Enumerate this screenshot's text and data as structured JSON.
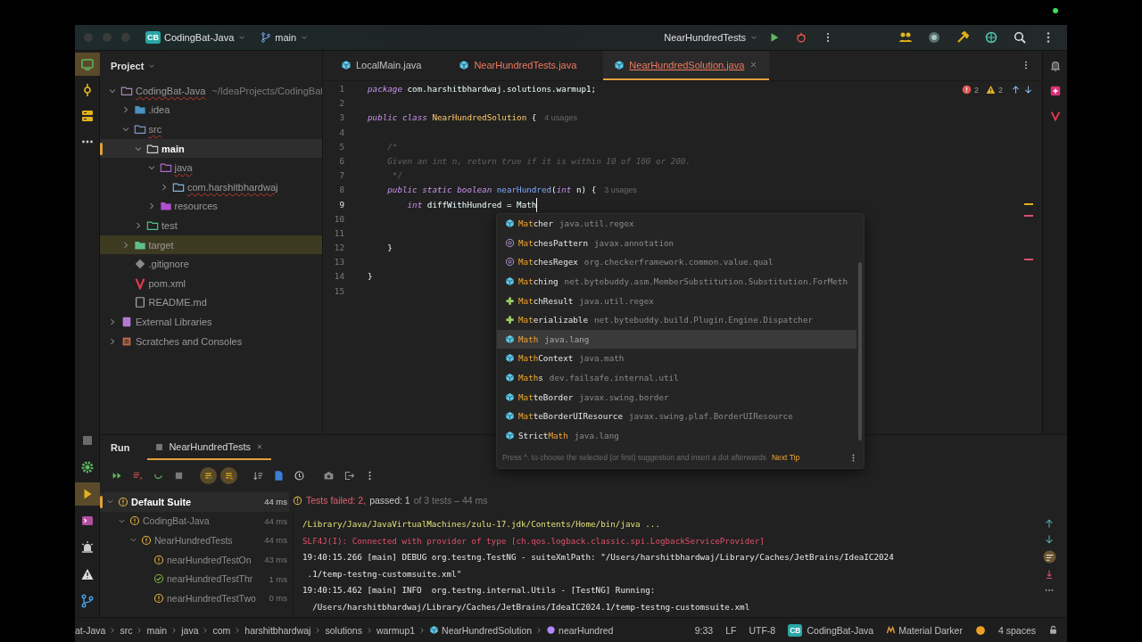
{
  "title_bar": {
    "project_badge": "CB",
    "project": "CodingBat-Java",
    "branch": "main",
    "run_config": "NearHundredTests"
  },
  "left_toolbar": {
    "top": [
      {
        "selected": true
      },
      {
        "selected": false
      },
      {
        "selected": false
      },
      {
        "selected": false
      }
    ],
    "bottom": [
      {
        "selected": false
      },
      {
        "selected": false
      },
      {
        "selected": true
      },
      {
        "selected": false
      },
      {
        "selected": false
      },
      {
        "selected": false
      },
      {
        "selected": false
      }
    ]
  },
  "project_panel": {
    "title": "Project",
    "tree": [
      {
        "label": "CodingBat-Java",
        "path": "~/IdeaProjects/CodingBat",
        "kind": "module",
        "expanded": true,
        "selected": false,
        "highlighted": false,
        "errors": true,
        "children": [
          {
            "label": ".idea",
            "kind": "config-folder",
            "expanded": false,
            "selected": false,
            "highlighted": false,
            "errors": false
          },
          {
            "label": "src",
            "kind": "source-folder",
            "expanded": true,
            "selected": false,
            "highlighted": false,
            "errors": true,
            "children": [
              {
                "label": "main",
                "kind": "folder",
                "expanded": true,
                "selected": true,
                "highlighted": false,
                "errors": false,
                "children": [
                  {
                    "label": "java",
                    "kind": "source-root",
                    "expanded": true,
                    "selected": false,
                    "highlighted": false,
                    "errors": true,
                    "children": [
                      {
                        "label": "com.harshitbhardwaj",
                        "kind": "package",
                        "expanded": false,
                        "selected": false,
                        "highlighted": false,
                        "errors": true
                      }
                    ]
                  },
                  {
                    "label": "resources",
                    "kind": "resource-root",
                    "expanded": false,
                    "selected": false,
                    "highlighted": false,
                    "errors": false
                  }
                ]
              },
              {
                "label": "test",
                "kind": "test-root",
                "expanded": false,
                "selected": false,
                "highlighted": false,
                "errors": false
              }
            ]
          },
          {
            "label": "target",
            "kind": "excluded-folder",
            "expanded": false,
            "selected": false,
            "highlighted": true,
            "errors": false
          },
          {
            "label": ".gitignore",
            "kind": "git-file",
            "selected": false,
            "highlighted": false,
            "errors": false
          },
          {
            "label": "pom.xml",
            "kind": "maven-file",
            "selected": false,
            "highlighted": false,
            "errors": false
          },
          {
            "label": "README.md",
            "kind": "markdown-file",
            "selected": false,
            "highlighted": false,
            "errors": false
          }
        ]
      },
      {
        "label": "External Libraries",
        "kind": "libraries",
        "expanded": false,
        "selected": false,
        "highlighted": false,
        "errors": false
      },
      {
        "label": "Scratches and Consoles",
        "kind": "scratches",
        "expanded": false,
        "selected": false,
        "highlighted": false,
        "errors": false
      }
    ]
  },
  "editor": {
    "tabs": [
      {
        "label": "LocalMain.java",
        "selected": false,
        "errors": false
      },
      {
        "label": "NearHundredTests.java",
        "selected": false,
        "errors": true
      },
      {
        "label": "NearHundredSolution.java",
        "selected": true,
        "errors": true
      }
    ],
    "inspections": {
      "errors": "2",
      "warnings": "2"
    },
    "lines": [
      {
        "number": "1",
        "current": false,
        "tokens": [
          {
            "kind": "keyword",
            "text": "package"
          },
          {
            "kind": "plain",
            "text": " com.harshitbhardwaj.solutions.warmup1;"
          }
        ]
      },
      {
        "number": "2",
        "current": false
      },
      {
        "number": "3",
        "current": false,
        "tokens": [
          {
            "kind": "keyword",
            "text": "public class"
          },
          {
            "kind": "type",
            "text": " NearHundredSolution"
          },
          {
            "kind": "plain",
            "text": " {"
          }
        ],
        "hint": "4 usages"
      },
      {
        "number": "4",
        "current": false
      },
      {
        "number": "5",
        "current": false,
        "tokens": [
          {
            "kind": "comment",
            "text": "    /*"
          }
        ]
      },
      {
        "number": "6",
        "current": false,
        "tokens": [
          {
            "kind": "comment",
            "text": "    Given an int n, return true if it is within 10 of 100 or 200."
          }
        ]
      },
      {
        "number": "7",
        "current": false,
        "tokens": [
          {
            "kind": "comment",
            "text": "     */"
          }
        ]
      },
      {
        "number": "8",
        "current": false,
        "tokens": [
          {
            "kind": "keyword",
            "text": "    public static boolean"
          },
          {
            "kind": "method",
            "text": " nearHundred"
          },
          {
            "kind": "plain",
            "text": "("
          },
          {
            "kind": "keyword",
            "text": "int"
          },
          {
            "kind": "plain",
            "text": " n) {"
          }
        ],
        "hint": "3 usages"
      },
      {
        "number": "9",
        "current": true,
        "tokens": [
          {
            "kind": "keyword",
            "text": "        int"
          },
          {
            "kind": "plain",
            "text": " diffWithHundred = Math"
          }
        ]
      },
      {
        "number": "10",
        "current": false
      },
      {
        "number": "11",
        "current": false
      },
      {
        "number": "12",
        "current": false,
        "tokens": [
          {
            "kind": "plain",
            "text": "    }"
          }
        ]
      },
      {
        "number": "13",
        "current": false
      },
      {
        "number": "14",
        "current": false,
        "tokens": [
          {
            "kind": "plain",
            "text": "}"
          }
        ]
      },
      {
        "number": "15",
        "current": false
      }
    ],
    "completion": {
      "items": [
        {
          "name": "**Mat**cher",
          "package": "java.util.regex",
          "kind": "class",
          "selected": false
        },
        {
          "name": "**Mat**chesPattern",
          "package": "javax.annotation",
          "kind": "annotation",
          "selected": false
        },
        {
          "name": "**Mat**chesRegex",
          "package": "org.checkerframework.common.value.qual",
          "kind": "annotation",
          "selected": false
        },
        {
          "name": "**Mat**ching",
          "package": "net.bytebuddy.asm.MemberSubstitution.Substitution.ForMeth",
          "kind": "class",
          "selected": false
        },
        {
          "name": "**Mat**chResult",
          "package": "java.util.regex",
          "kind": "interface",
          "selected": false
        },
        {
          "name": "**Mat**erializable",
          "package": "net.bytebuddy.build.Plugin.Engine.Dispatcher",
          "kind": "interface",
          "selected": false
        },
        {
          "name": "**Math**",
          "package": "java.lang",
          "kind": "class",
          "selected": true
        },
        {
          "name": "**Math**Context",
          "package": "java.math",
          "kind": "class",
          "selected": false
        },
        {
          "name": "**Math**s",
          "package": "dev.failsafe.internal.util",
          "kind": "class",
          "selected": false
        },
        {
          "name": "**Mat**teBorder",
          "package": "javax.swing.border",
          "kind": "class",
          "selected": false
        },
        {
          "name": "**Mat**teBorderUIResource",
          "package": "javax.swing.plaf.BorderUIResource",
          "kind": "class",
          "selected": false
        },
        {
          "name": "Strict**Math**",
          "package": "java.lang",
          "kind": "class",
          "selected": false
        }
      ],
      "hint": "Press ^. to choose the selected (or first) suggestion and insert a dot afterwards",
      "next_tip": "Next Tip"
    }
  },
  "run_panel": {
    "title": "Run",
    "tabs": [
      {
        "label": "NearHundredTests",
        "selected": true
      }
    ],
    "toolbar": [
      {
        "on": false
      },
      {
        "on": false
      },
      {
        "on": false
      },
      {
        "on": false
      },
      {
        "on": true
      },
      {
        "on": true
      },
      {
        "on": false
      },
      {
        "on": false
      },
      {
        "on": false
      },
      {
        "on": false
      },
      {
        "on": false
      },
      {
        "on": false
      }
    ],
    "tests": [
      {
        "label": "Default Suite",
        "time": "44 ms",
        "failed": true,
        "selected": true,
        "expanded": true,
        "children": [
          {
            "label": "CodingBat-Java",
            "time": "44 ms",
            "failed": true,
            "selected": false,
            "expanded": true,
            "children": [
              {
                "label": "NearHundredTests",
                "time": "44 ms",
                "failed": true,
                "selected": false,
                "expanded": true,
                "children": [
                  {
                    "label": "nearHundredTestOn",
                    "time": "43 ms",
                    "failed": true,
                    "selected": false
                  },
                  {
                    "label": "nearHundredTestThr",
                    "time": "1 ms",
                    "failed": false,
                    "selected": false
                  },
                  {
                    "label": "nearHundredTestTwo",
                    "time": "0 ms",
                    "failed": true,
                    "selected": false
                  }
                ]
              }
            ]
          }
        ]
      }
    ],
    "summary": {
      "failed": "Tests failed: 2,",
      "passed": "passed: 1",
      "total": "of 3 tests – 44 ms"
    },
    "console": [
      {
        "kind": "command",
        "text": "/Library/Java/JavaVirtualMachines/zulu-17.jdk/Contents/Home/bin/java ..."
      },
      {
        "kind": "error",
        "text": "SLF4J(I): Connected with provider of type [ch.qos.logback.classic.spi.LogbackServiceProvider]"
      },
      {
        "kind": "log",
        "text": "19:40:15.266 [main] DEBUG org.testng.TestNG - suiteXmlPath: \"/Users/harshitbhardwaj/Library/Caches/JetBrains/IdeaIC2024"
      },
      {
        "kind": "log",
        "text": " .1/temp-testng-customsuite.xml\""
      },
      {
        "kind": "log",
        "text": "19:40:15.462 [main] INFO  org.testng.internal.Utils - [TestNG] Running:"
      },
      {
        "kind": "log",
        "text": "  /Users/harshitbhardwaj/Library/Caches/JetBrains/IdeaIC2024.1/temp-testng-customsuite.xml"
      }
    ]
  },
  "status_bar": {
    "breadcrumbs": [
      {
        "label": "at-Java",
        "kind": "folder"
      },
      {
        "label": "src",
        "kind": "folder"
      },
      {
        "label": "main",
        "kind": "folder"
      },
      {
        "label": "java",
        "kind": "folder"
      },
      {
        "label": "com",
        "kind": "folder"
      },
      {
        "label": "harshitbhardwaj",
        "kind": "folder"
      },
      {
        "label": "solutions",
        "kind": "folder"
      },
      {
        "label": "warmup1",
        "kind": "folder"
      },
      {
        "label": "NearHundredSolution",
        "kind": "class"
      },
      {
        "label": "nearHundred",
        "kind": "method"
      }
    ],
    "position": "9:33",
    "line_ending": "LF",
    "encoding": "UTF-8",
    "project_badge": "CB",
    "project": "CodingBat-Java",
    "theme": "Material Darker",
    "indent": "4 spaces"
  }
}
